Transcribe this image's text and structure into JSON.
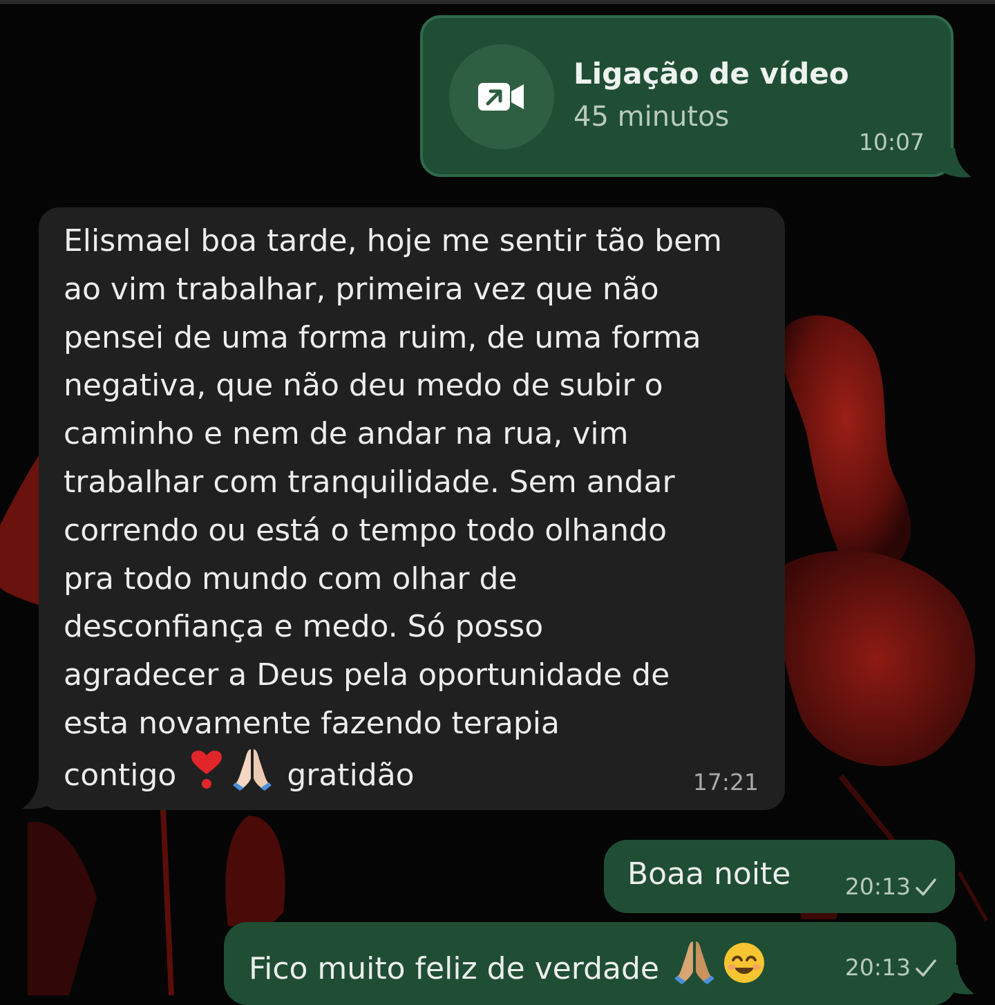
{
  "call": {
    "title": "Ligação de vídeo",
    "duration": "45 minutos",
    "time": "10:07",
    "icon": "outgoing-video-call-icon"
  },
  "incoming": {
    "lines": [
      "Elismael boa tarde, hoje me sentir tão bem",
      "ao vim trabalhar, primeira vez que não",
      "pensei de uma forma ruim, de uma forma",
      "negativa, que não deu medo de subir o",
      "caminho e nem de andar na rua, vim",
      "trabalhar com tranquilidade. Sem andar",
      "correndo ou está o tempo todo olhando",
      "pra todo mundo com olhar de",
      "desconfiança e medo. Só posso",
      "agradecer a Deus pela oportunidade de",
      "esta novamente fazendo terapia"
    ],
    "last_line_start": "contigo",
    "emojis": [
      "heart-exclamation-emoji",
      "folded-hands-emoji"
    ],
    "last_line_end": "gratidão",
    "time": "17:21"
  },
  "outgoing": [
    {
      "text": "Boaa noite",
      "time": "20:13",
      "status": "sent-check-icon"
    },
    {
      "text": "Fico muito feliz de verdade",
      "emojis": [
        "folded-hands-emoji",
        "smiling-face-emoji"
      ],
      "time": "20:13",
      "status": "sent-check-icon"
    }
  ],
  "colors": {
    "outgoing_bubble": "#1f4e35",
    "incoming_bubble": "#202020",
    "wallpaper": "#050505",
    "wallpaper_accent": "#8a1a14"
  }
}
